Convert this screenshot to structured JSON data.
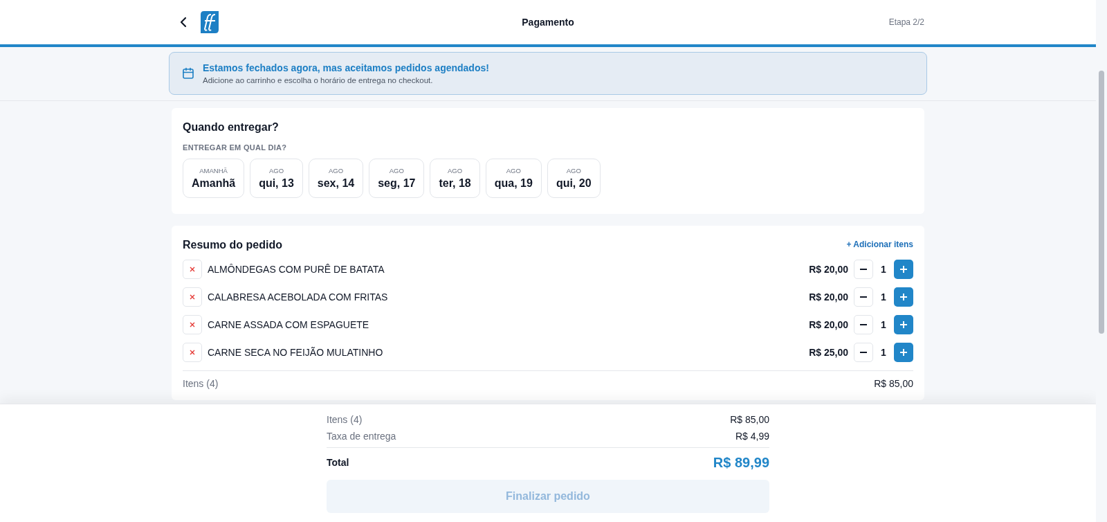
{
  "header": {
    "title": "Pagamento",
    "step": "Etapa 2/2"
  },
  "banner": {
    "title": "Estamos fechados agora, mas aceitamos pedidos agendados!",
    "text": "Adicione ao carrinho e escolha o horário de entrega no checkout."
  },
  "delivery": {
    "title": "Quando entregar?",
    "label": "ENTREGAR EM QUAL DIA?",
    "days": [
      {
        "month": "AMANHÃ",
        "day": "Amanhã",
        "selected": false
      },
      {
        "month": "AGO",
        "day": "qui, 13",
        "selected": false
      },
      {
        "month": "AGO",
        "day": "sex, 14",
        "selected": false
      },
      {
        "month": "AGO",
        "day": "seg, 17",
        "selected": false
      },
      {
        "month": "AGO",
        "day": "ter, 18",
        "selected": false
      },
      {
        "month": "AGO",
        "day": "qua, 19",
        "selected": false
      },
      {
        "month": "AGO",
        "day": "qui, 20",
        "selected": false
      }
    ]
  },
  "order": {
    "title": "Resumo do pedido",
    "add_link": "+ Adicionar itens",
    "items": [
      {
        "name": "ALMÔNDEGAS COM PURÊ DE BATATA",
        "price": "R$ 20,00",
        "qty": "1"
      },
      {
        "name": "CALABRESA ACEBOLADA COM FRITAS",
        "price": "R$ 20,00",
        "qty": "1"
      },
      {
        "name": "CARNE ASSADA COM ESPAGUETE",
        "price": "R$ 20,00",
        "qty": "1"
      },
      {
        "name": "CARNE SECA NO FEIJÃO MULATINHO",
        "price": "R$ 25,00",
        "qty": "1"
      }
    ],
    "summary": [
      {
        "label": "Itens (4)",
        "value": "R$ 85,00"
      }
    ]
  },
  "checkout": {
    "rows": [
      {
        "label": "Itens (4)",
        "value": "R$ 85,00"
      },
      {
        "label": "Taxa de entrega",
        "value": "R$ 4,99"
      }
    ],
    "total_label": "Total",
    "total": "R$ 89,99",
    "button": "Finalizar pedido",
    "button_disabled": true
  }
}
